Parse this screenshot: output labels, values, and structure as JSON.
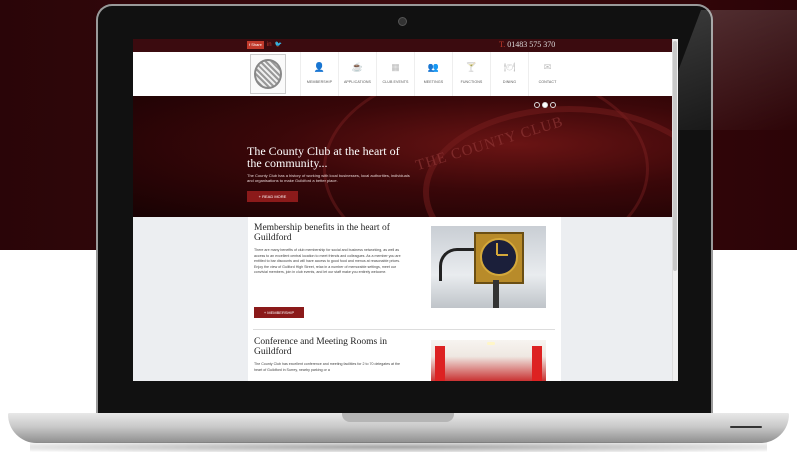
{
  "topbar": {
    "facebook_label": "f Share",
    "linkedin_label": "in",
    "twitter_label": "🐦",
    "phone_prefix": "T.",
    "phone": "01483 575 370"
  },
  "nav": {
    "items": [
      {
        "label": "MEMBERSHIP",
        "icon": "👤"
      },
      {
        "label": "APPLICATIONS",
        "icon": "☕"
      },
      {
        "label": "CLUB EVENTS",
        "icon": "▦"
      },
      {
        "label": "MEETINGS",
        "icon": "👥"
      },
      {
        "label": "FUNCTIONS",
        "icon": "🍸"
      },
      {
        "label": "DINING",
        "icon": "🍽"
      },
      {
        "label": "CONTACT",
        "icon": "✉"
      }
    ]
  },
  "hero": {
    "title": "The County Club at the heart of the community...",
    "text": "The County Club has a history of working with local businesses, local authorities, individuals and organisations to make Guildford a better place.",
    "button": "+ READ MORE",
    "engraving": "THE COUNTY CLUB"
  },
  "sections": {
    "membership": {
      "title": "Membership benefits in the heart of Guildford",
      "text": "There are many benefits of club membership for social and business networking, as well as access to an excellent central location to meet friends and colleagues. As a member you are entitled to bar discounts and will have access to good food and menus at reasonable prices. Enjoy the view of Guilford High Street, relax in a number of memorable settings, meet our convivial members, join in club events, and let our staff make you entirely welcome.",
      "button": "+ MEMBERSHIP"
    },
    "conference": {
      "title": "Conference and Meeting Rooms in Guildford",
      "text": "The County Club has excellent conference and meeting facilities for 2 to 70 delegates at the heart of Guildford in Surrey, nearby parking or a"
    }
  },
  "colors": {
    "brand": "#3b0b0f",
    "accent": "#8b1a1a"
  }
}
